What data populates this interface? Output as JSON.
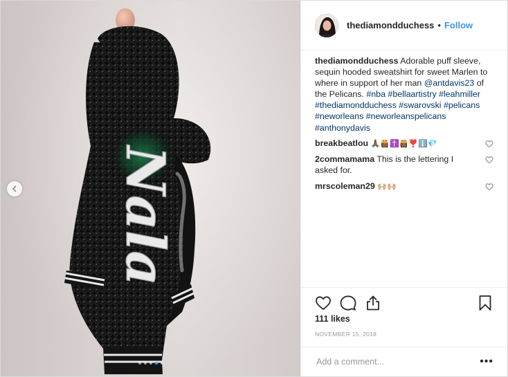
{
  "post": {
    "username": "thediamondduchess",
    "separator": "•",
    "follow_label": "Follow",
    "caption": {
      "user": "thediamondduchess",
      "text": " Adorable puff sleeve, sequin hooded sweatshirt for sweet Marlen to where in support of her man ",
      "mention": "@antdavis23",
      "text2": " of the Pelicans. ",
      "tags": [
        "#nba",
        "#bellaartistry",
        "#leahmiller",
        "#thediamondduchess",
        "#swarovski",
        "#pelicans",
        "#neworleans",
        "#neworleanspelicans",
        "#anthonydavis"
      ]
    },
    "comments": [
      {
        "user": "breakbeatlou",
        "text": "",
        "emoji": "🙏🏾👸🏾✝️👸🏾❣️ℹ️💎"
      },
      {
        "user": "2commamama",
        "text": "This is the lettering I asked for.",
        "emoji": ""
      },
      {
        "user": "mrscoleman29",
        "text": "",
        "emoji": "🙌🏼🙌🏼"
      }
    ],
    "likes": "111 likes",
    "date": "NOVEMBER 15, 2018",
    "comment_placeholder": "Add a comment...",
    "more_label": "•••"
  },
  "media": {
    "jacket_lettering": "Nala",
    "carousel_total": 5,
    "carousel_active": 4
  },
  "colors": {
    "link": "#003569",
    "follow": "#3897f0",
    "muted": "#999999",
    "dot_active": "#4fa3e7"
  },
  "icons": [
    "chevron-left-icon",
    "heart-icon",
    "comment-icon",
    "share-icon",
    "bookmark-icon",
    "more-icon"
  ]
}
